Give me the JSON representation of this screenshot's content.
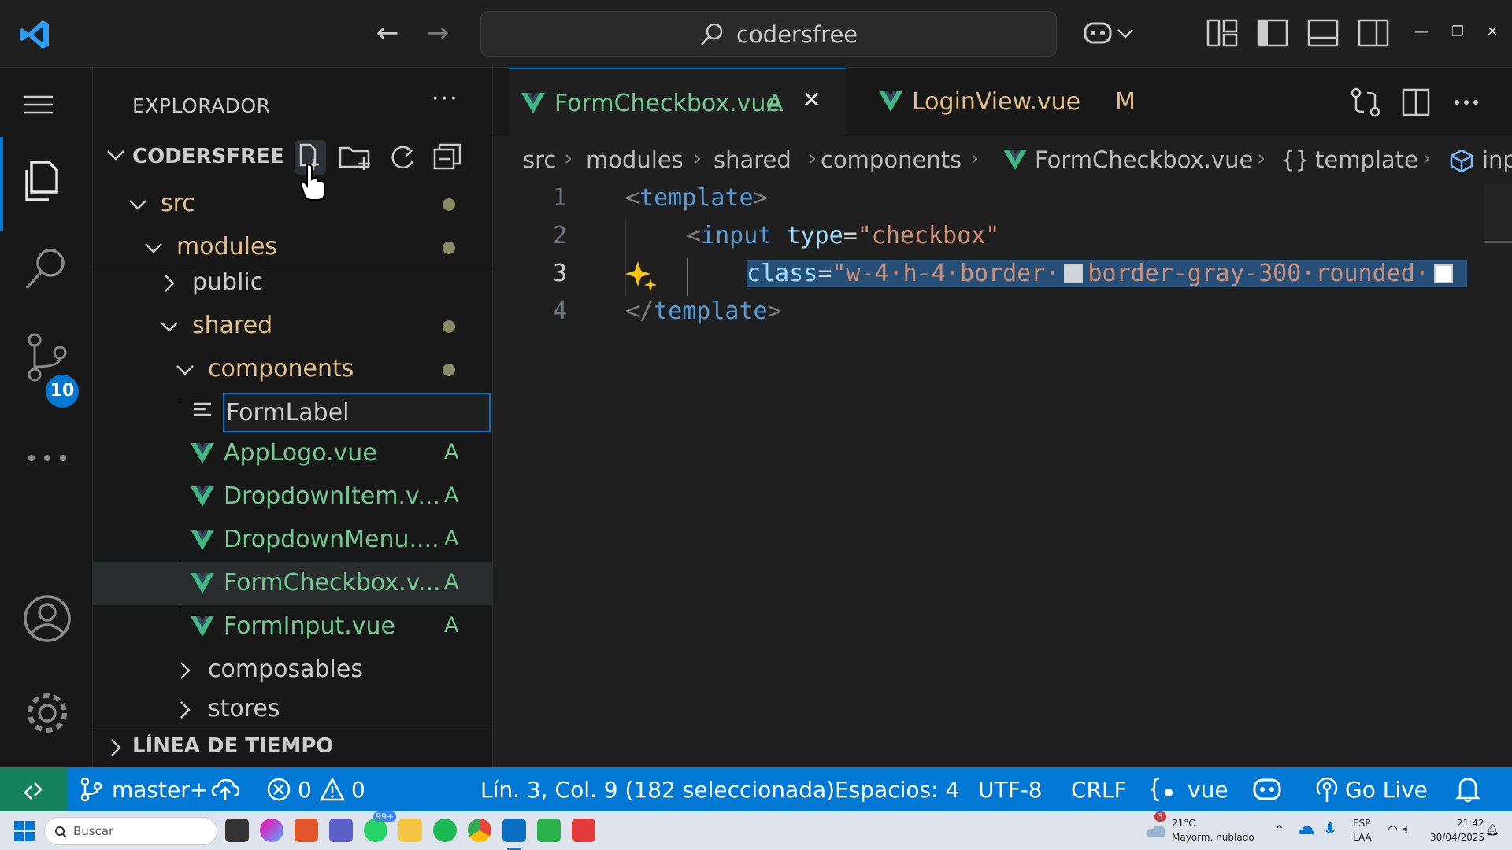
{
  "titlebar": {
    "search_text": "codersfree",
    "nav_back_icon": "arrow-left-icon",
    "nav_forward_icon": "arrow-right-icon"
  },
  "activity": {
    "scm_badge": "10"
  },
  "sidebar": {
    "title": "EXPLORADOR",
    "more": "···",
    "workspace": "CODERSFREE",
    "tree": {
      "src": "src",
      "modules": "modules",
      "public": "public",
      "shared": "shared",
      "components": "components",
      "rename_value": "FormLabel",
      "files": [
        {
          "name": "AppLogo.vue",
          "status": "A"
        },
        {
          "name": "DropdownItem.v...",
          "status": "A"
        },
        {
          "name": "DropdownMenu....",
          "status": "A"
        },
        {
          "name": "FormCheckbox.v...",
          "status": "A"
        },
        {
          "name": "FormInput.vue",
          "status": "A"
        }
      ],
      "composables": "composables",
      "stores": "stores"
    },
    "timeline": "LÍNEA DE TIEMPO"
  },
  "tabs": [
    {
      "name": "FormCheckbox.vue",
      "status": "A"
    },
    {
      "name": "LoginView.vue",
      "status": "M"
    }
  ],
  "breadcrumb": [
    "src",
    "modules",
    "shared",
    "components",
    "FormCheckbox.vue",
    "template",
    "inp"
  ],
  "breadcrumb_braces": "{}",
  "editor": {
    "line_numbers": [
      "1",
      "2",
      "3",
      "4"
    ],
    "line1": {
      "open": "<",
      "tag": "template",
      "close": ">"
    },
    "line2": {
      "open": "<",
      "tag": "input",
      "attr": "type",
      "eq": "=",
      "val": "\"checkbox\""
    },
    "line3": {
      "attr": "class",
      "eq": "=",
      "val_a": "\"w-4·h-4·border·",
      "val_b": "border-gray-300·rounded·"
    },
    "line4": {
      "open": "</",
      "tag": "template",
      "close": ">"
    }
  },
  "statusbar": {
    "branch": "master+",
    "errors": "0",
    "warnings": "0",
    "position": "Lín. 3, Col. 9 (182 seleccionada)",
    "spaces": "Espacios: 4",
    "encoding": "UTF-8",
    "eol": "CRLF",
    "language": "vue",
    "golive": "Go Live"
  },
  "taskbar": {
    "search": "Buscar",
    "weather_temp": "21°C",
    "weather_desc": "Mayorm. nublado",
    "lang1": "ESP",
    "lang2": "LAA",
    "time": "21:42",
    "date": "30/04/2025",
    "whatsapp_badge": "99+",
    "weather_badge": "3"
  },
  "colors": {
    "accent": "#0078d4",
    "added": "#73c991",
    "modified": "#e2c08d",
    "vue_green": "#41b883"
  }
}
